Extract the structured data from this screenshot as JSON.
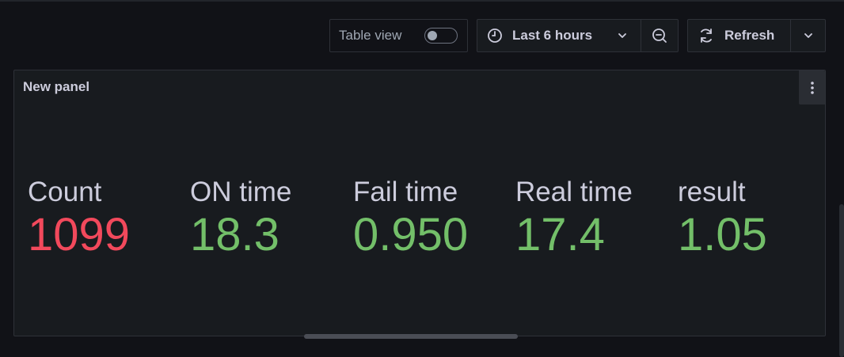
{
  "toolbar": {
    "table_view_label": "Table view",
    "table_view_enabled": false,
    "time_range_label": "Last 6 hours",
    "refresh_label": "Refresh"
  },
  "panel": {
    "title": "New panel",
    "stats": [
      {
        "name": "Count",
        "value": "1099",
        "color": "#f2495c"
      },
      {
        "name": "ON time",
        "value": "18.3",
        "color": "#73bf69"
      },
      {
        "name": "Fail time",
        "value": "0.950",
        "color": "#73bf69"
      },
      {
        "name": "Real time",
        "value": "17.4",
        "color": "#73bf69"
      },
      {
        "name": "result",
        "value": "1.05",
        "color": "#73bf69"
      }
    ]
  },
  "icons": {
    "clock": "clock-icon",
    "zoom_out": "zoom-out-icon",
    "refresh": "refresh-icon",
    "chevron": "chevron-down-icon",
    "menu": "kebab-menu-icon"
  }
}
